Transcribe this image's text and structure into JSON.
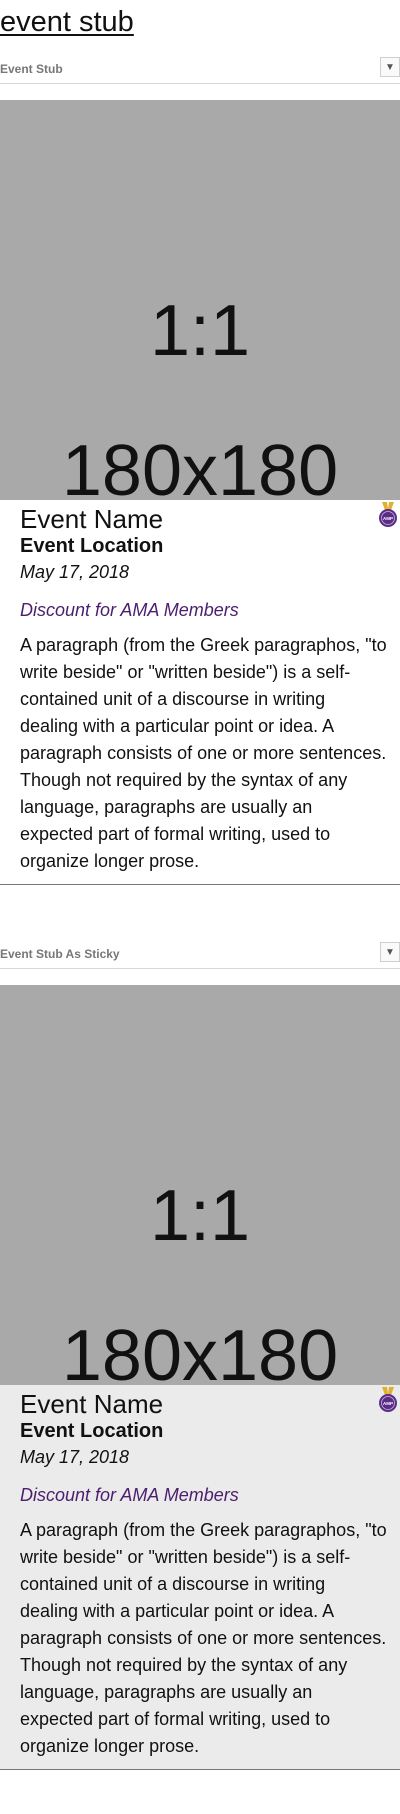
{
  "page": {
    "title": "event stub"
  },
  "sections": [
    {
      "header_label": "Event Stub",
      "toggle_icon": "▼",
      "image": {
        "line1": "1:1",
        "line2": "180x180"
      },
      "event": {
        "name": "Event Name",
        "location": "Event Location",
        "date": "May 17, 2018",
        "discount": "Discount for AMA Members",
        "description": "A paragraph (from the Greek paragraphos, \"to write beside\" or \"written beside\") is a self-contained unit of a discourse in writing dealing with a particular point or idea. A paragraph consists of one or more sentences. Though not required by the syntax of any language, paragraphs are usually an expected part of formal writing, used to organize longer prose.",
        "badge_icon": "medal-badge-icon",
        "badge_text": "AMP"
      }
    },
    {
      "header_label": "Event Stub As Sticky",
      "toggle_icon": "▼",
      "image": {
        "line1": "1:1",
        "line2": "180x180"
      },
      "event": {
        "name": "Event Name",
        "location": "Event Location",
        "date": "May 17, 2018",
        "discount": "Discount for AMA Members",
        "description": "A paragraph (from the Greek paragraphos, \"to write beside\" or \"written beside\") is a self-contained unit of a discourse in writing dealing with a particular point or idea. A paragraph consists of one or more sentences. Though not required by the syntax of any language, paragraphs are usually an expected part of formal writing, used to organize longer prose.",
        "badge_icon": "medal-badge-icon",
        "badge_text": "AMP"
      }
    }
  ],
  "colors": {
    "placeholder_bg": "#a9a9a9",
    "discount_text": "#4b1e6e",
    "sticky_bg": "#ebebeb",
    "badge_purple": "#5b2d86",
    "badge_gold": "#e0b030"
  }
}
